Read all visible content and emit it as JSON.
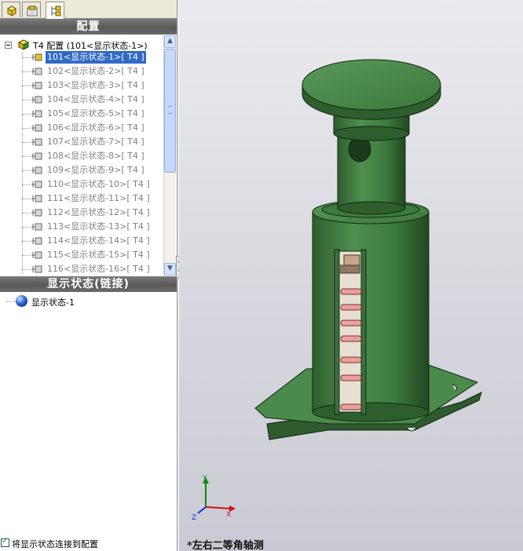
{
  "tabs": [
    {
      "name": "feature-manager",
      "active": false
    },
    {
      "name": "property-manager",
      "active": false
    },
    {
      "name": "configuration-manager",
      "active": true
    }
  ],
  "config_panel": {
    "title": "配置",
    "root_label": "T4 配置 (101<显示状态-1>)",
    "items": [
      {
        "label": "101<显示状态-1>[ T4 ]",
        "selected": true
      },
      {
        "label": "102<显示状态-2>[ T4 ]",
        "selected": false
      },
      {
        "label": "103<显示状态-3>[ T4 ]",
        "selected": false
      },
      {
        "label": "104<显示状态-4>[ T4 ]",
        "selected": false
      },
      {
        "label": "105<显示状态-5>[ T4 ]",
        "selected": false
      },
      {
        "label": "106<显示状态-6>[ T4 ]",
        "selected": false
      },
      {
        "label": "107<显示状态-7>[ T4 ]",
        "selected": false
      },
      {
        "label": "108<显示状态-8>[ T4 ]",
        "selected": false
      },
      {
        "label": "109<显示状态-9>[ T4 ]",
        "selected": false
      },
      {
        "label": "110<显示状态-10>[ T4 ]",
        "selected": false
      },
      {
        "label": "111<显示状态-11>[ T4 ]",
        "selected": false
      },
      {
        "label": "112<显示状态-12>[ T4 ]",
        "selected": false
      },
      {
        "label": "113<显示状态-13>[ T4 ]",
        "selected": false
      },
      {
        "label": "114<显示状态-14>[ T4 ]",
        "selected": false
      },
      {
        "label": "115<显示状态-15>[ T4 ]",
        "selected": false
      },
      {
        "label": "116<显示状态-16>[ T4 ]",
        "selected": false
      }
    ]
  },
  "display_panel": {
    "title": "显示状态(链接)",
    "items": [
      {
        "label": "显示状态-1",
        "icon": "sphere-icon"
      }
    ]
  },
  "link_checkbox": {
    "label": "将显示状态连接到配置",
    "checked": true
  },
  "viewport": {
    "view_label": "*左右二等角轴测",
    "triad": {
      "x": "X",
      "y": "Y",
      "z": "Z"
    },
    "colors": {
      "part": "#3f7a3f",
      "spring": "#e8a0a0",
      "background": "#dcdde3"
    }
  },
  "colors": {
    "selection": "#316ac5",
    "header": "#6a6a6a"
  }
}
